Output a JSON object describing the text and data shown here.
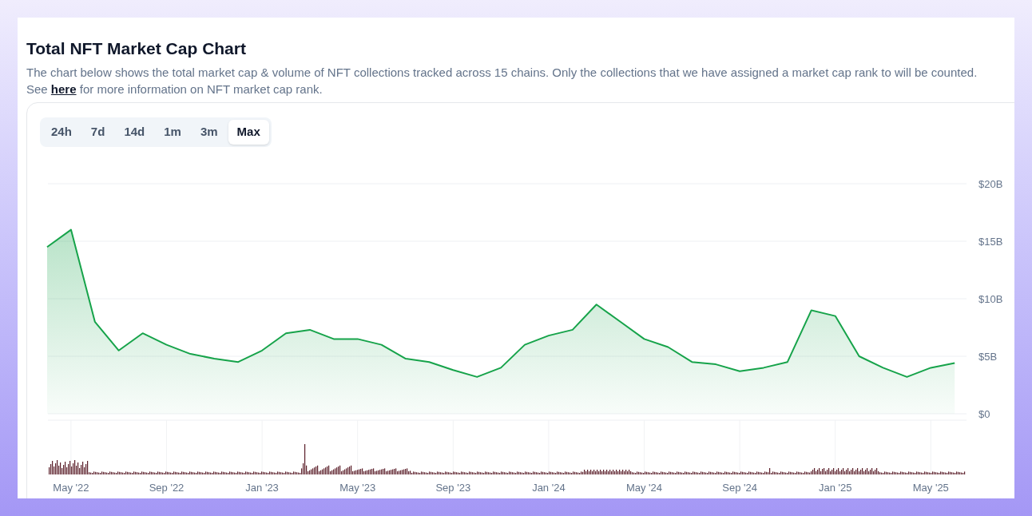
{
  "heading": "Total NFT Market Cap Chart",
  "description": "The chart below shows the total market cap & volume of NFT collections tracked across 15 chains. Only the collections that we have assigned a market cap rank to will be counted.",
  "description_line2": {
    "before": "See",
    "link": "here",
    "after": "for more information on NFT market cap rank."
  },
  "range_tabs": [
    {
      "label": "24h",
      "selected": false
    },
    {
      "label": "7d",
      "selected": false
    },
    {
      "label": "14d",
      "selected": false
    },
    {
      "label": "1m",
      "selected": false
    },
    {
      "label": "3m",
      "selected": false
    },
    {
      "label": "Max",
      "selected": true
    }
  ],
  "chart_data": {
    "type": "area",
    "categories": [
      null,
      "May '22",
      null,
      null,
      null,
      "Sep '22",
      null,
      null,
      null,
      "Jan '23",
      null,
      null,
      null,
      "May '23",
      null,
      null,
      null,
      "Sep '23",
      null,
      null,
      null,
      "Jan '24",
      null,
      null,
      null,
      "May '24",
      null,
      null,
      null,
      "Sep '24",
      null,
      null,
      null,
      "Jan '25",
      null,
      null,
      null,
      "May '25",
      null
    ],
    "series": [
      {
        "color": "#16a34a",
        "values": [
          14.5,
          16,
          8,
          5.5,
          7,
          6,
          5.2,
          4.8,
          4.5,
          5.5,
          7,
          7.3,
          6.5,
          6.5,
          6,
          4.8,
          4.5,
          3.8,
          3.2,
          4,
          6,
          6.8,
          7.3,
          9.5,
          8,
          6.5,
          5.8,
          4.5,
          4.3,
          3.7,
          4,
          4.5,
          9,
          8.5,
          5,
          4,
          3.2,
          4,
          4.4
        ]
      }
    ],
    "yticks": [
      {
        "value": 0,
        "label": "$0"
      },
      {
        "value": 5,
        "label": "$5B"
      },
      {
        "value": 10,
        "label": "$10B"
      },
      {
        "value": 15,
        "label": "$15B"
      },
      {
        "value": 20,
        "label": "$20B"
      }
    ],
    "ylim": [
      0,
      20
    ],
    "grid": true
  }
}
